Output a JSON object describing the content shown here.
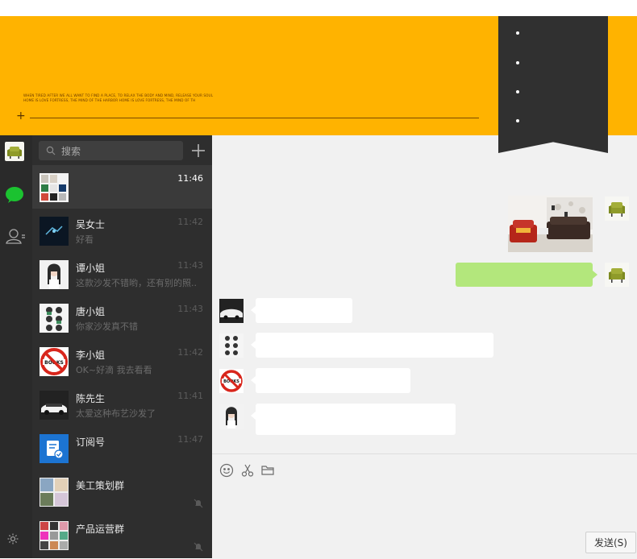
{
  "banner": {
    "tagline_1": "WHEN TIRED AFTER WE ALL WANT TO FIND A PLACE, TO RELAX THE BODY AND MIND, RELEASE YOUR SOUL",
    "tagline_2": "HOME IS LOVE FORTRESS, THE MIND OF THE HARBOR HOME IS LOVE FORTRESS, THE MIND OF TH",
    "ribbon_dots": 4
  },
  "search": {
    "placeholder": "搜索"
  },
  "conversations": [
    {
      "name": "",
      "preview": "",
      "time": "11:46",
      "active": true
    },
    {
      "name": "吴女士",
      "preview": "好看",
      "time": "11:42"
    },
    {
      "name": "谭小姐",
      "preview": "这款沙发不错哟，还有别的照...",
      "time": "11:43"
    },
    {
      "name": "唐小姐",
      "preview": "你家沙发真不错",
      "time": "11:43"
    },
    {
      "name": "李小姐",
      "preview": "OK~好滴   我去看看",
      "time": "11:42"
    },
    {
      "name": "陈先生",
      "preview": "太爱这种布艺沙发了",
      "time": "11:41"
    },
    {
      "name": "订阅号",
      "preview": "",
      "time": "11:47"
    },
    {
      "name": "美工策划群",
      "preview": "",
      "time": ""
    },
    {
      "name": "产品运营群",
      "preview": "",
      "time": ""
    }
  ],
  "composer": {
    "send_label": "发送(S)"
  },
  "colors": {
    "banner": "#ffb300",
    "sidebar": "#2a2a2a",
    "list": "#2e2e2e",
    "bubble_me": "#b3e77c",
    "chat_bg": "#f1f1f1"
  }
}
